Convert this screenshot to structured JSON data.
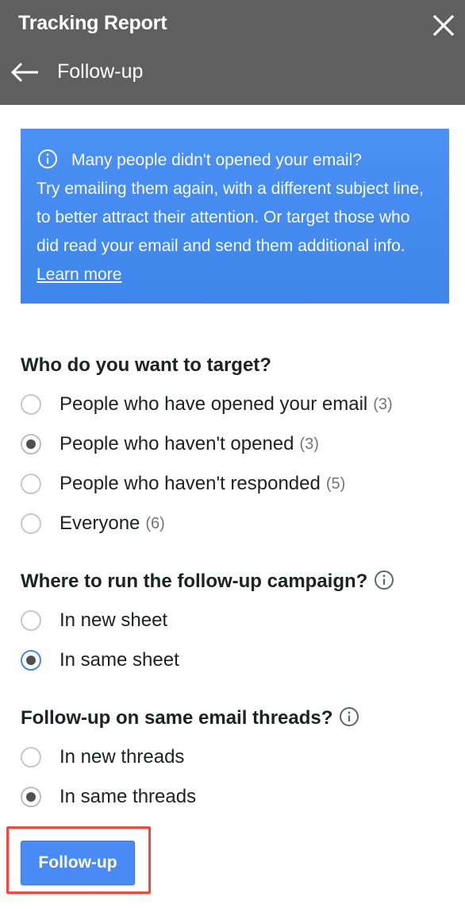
{
  "header": {
    "app_title": "Tracking Report",
    "sub_title": "Follow-up",
    "close_icon": "close-icon",
    "back_icon": "arrow-left-icon",
    "background": "#5f5f5f"
  },
  "info": {
    "icon": "info-icon",
    "line1": "Many people didn't opened your email?",
    "body": "Try emailing them again, with a different subject line, to better attract their attention. Or target those who did read your email and send them additional info.",
    "learn_more": "Learn more",
    "background": "#4a8ff0"
  },
  "target": {
    "title": "Who do you want to target?",
    "options": [
      {
        "label": "People who have opened your email",
        "count": "(3)",
        "selected": false
      },
      {
        "label": "People who haven't opened",
        "count": "(3)",
        "selected": true
      },
      {
        "label": "People who haven't responded",
        "count": "(5)",
        "selected": false
      },
      {
        "label": "Everyone",
        "count": "(6)",
        "selected": false
      }
    ]
  },
  "campaign": {
    "title": "Where to run the follow-up campaign?",
    "help_icon": "info-icon",
    "options": [
      {
        "label": "In new sheet",
        "selected": false
      },
      {
        "label": "In same sheet",
        "selected": true
      }
    ]
  },
  "threads": {
    "title": "Follow-up on same email threads?",
    "help_icon": "info-icon",
    "options": [
      {
        "label": "In new threads",
        "selected": false
      },
      {
        "label": "In same threads",
        "selected": true
      }
    ]
  },
  "action": {
    "button_label": "Follow-up",
    "button_color": "#4a8af4",
    "highlight_color": "#f0483e"
  }
}
